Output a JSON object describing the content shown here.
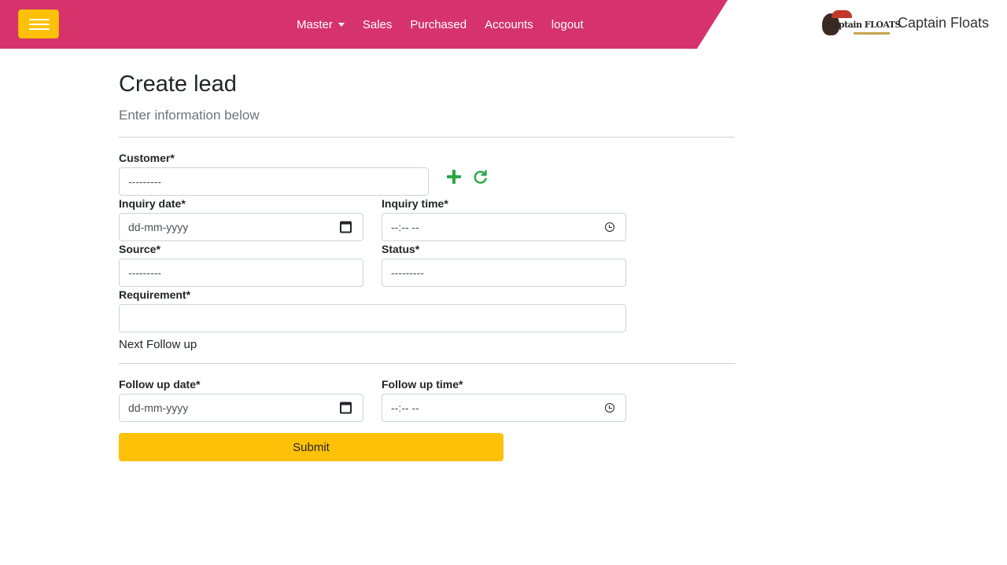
{
  "navbar": {
    "menu_icon": "hamburger-icon",
    "links": [
      "Master",
      "Sales",
      "Purchased",
      "Accounts",
      "logout"
    ],
    "brand_name": "Captain Floats",
    "logo_text": "Captain FLOATS",
    "colors": {
      "nav_bg": "#d6336c",
      "menu_btn": "#ffc107"
    }
  },
  "page": {
    "title": "Create lead",
    "subtitle": "Enter information below"
  },
  "form": {
    "customer_label": "Customer*",
    "customer_value": "---------",
    "add_icon": "plus-icon",
    "refresh_icon": "refresh-icon",
    "inquiry_date_label": "Inquiry date*",
    "inquiry_date_value": "dd-mm-yyyy",
    "inquiry_time_label": "Inquiry time*",
    "inquiry_time_value": "--:-- --",
    "source_label": "Source*",
    "source_value": "---------",
    "status_label": "Status*",
    "status_value": "---------",
    "requirement_label": "Requirement*",
    "requirement_value": "",
    "next_follow_label": "Next Follow up",
    "follow_date_label": "Follow up date*",
    "follow_date_value": "dd-mm-yyyy",
    "follow_time_label": "Follow up time*",
    "follow_time_value": "--:-- --",
    "submit_label": "Submit"
  }
}
